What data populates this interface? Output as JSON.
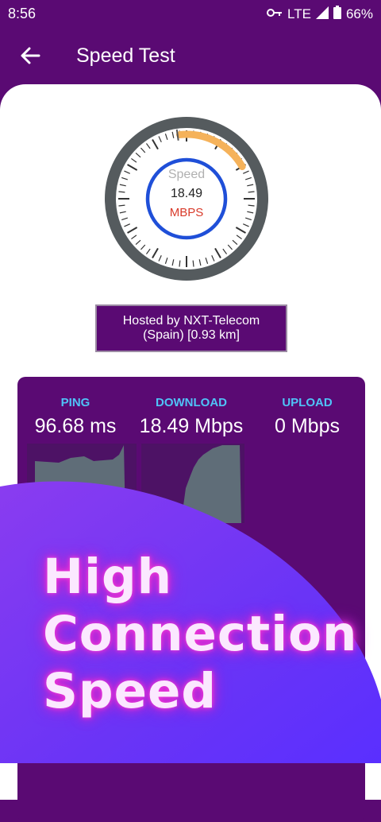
{
  "status_bar": {
    "time": "8:56",
    "network": "LTE",
    "battery": "66%"
  },
  "app_bar": {
    "title": "Speed Test"
  },
  "gauge": {
    "label": "Speed",
    "value": "18.49",
    "unit": "MBPS"
  },
  "server": {
    "line1": "Hosted by NXT-Telecom",
    "line2": "(Spain) [0.93 km]"
  },
  "stats": {
    "ping": {
      "label": "PING",
      "value": "96.68 ms"
    },
    "download": {
      "label": "DOWNLOAD",
      "value": "18.49 Mbps"
    },
    "upload": {
      "label": "UPLOAD",
      "value": "0 Mbps"
    }
  },
  "promo": {
    "line1": "High",
    "line2": "Connection",
    "line3": "Speed"
  },
  "colors": {
    "header": "#5a0a73",
    "accent_blue": "#1f4fd8",
    "gauge_orange": "#f5b25a",
    "unit_red": "#d83a2a",
    "label_cyan": "#4fc3f7"
  }
}
